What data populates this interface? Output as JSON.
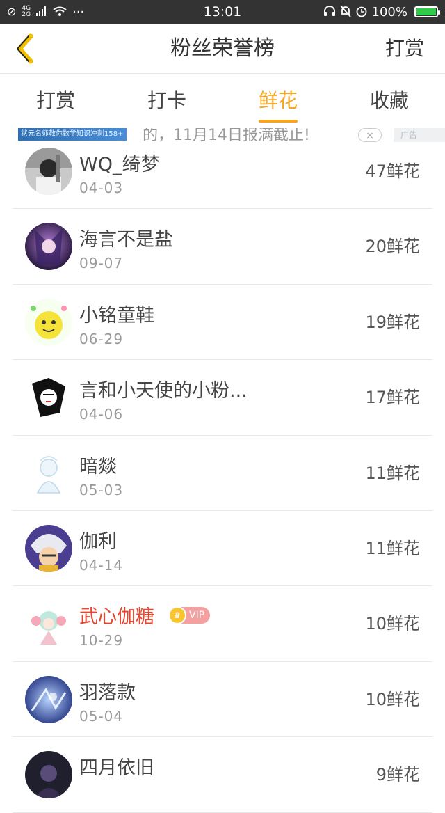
{
  "status_bar": {
    "time": "13:01",
    "network_label_top": "4G",
    "network_label_bottom": "2G",
    "more_glyph": "···",
    "battery_text": "100%",
    "battery_level": 1.0,
    "icons": [
      "blocked-icon",
      "signal-icon",
      "wifi-icon",
      "headset-icon",
      "mute-icon",
      "alarm-icon",
      "battery-charging-icon"
    ]
  },
  "header": {
    "title": "粉丝荣誉榜",
    "action_label": "打赏",
    "back_icon": "chevron-left-icon",
    "accent_color": "#f5a623"
  },
  "tabs": [
    {
      "label": "打赏",
      "active": false
    },
    {
      "label": "打卡",
      "active": false
    },
    {
      "label": "鲜花",
      "active": true
    },
    {
      "label": "收藏",
      "active": false
    }
  ],
  "ad": {
    "thumb_text": "状元名师教你数学知识冲刺158+",
    "text": "的，11月14日报满截止!",
    "close_glyph": "×",
    "mark_text": "广告"
  },
  "fans": [
    {
      "name": "WQ_绮梦",
      "date": "04-03",
      "count": "47鲜花",
      "vip": false
    },
    {
      "name": "海言不是盐",
      "date": "09-07",
      "count": "20鲜花",
      "vip": false
    },
    {
      "name": "小铭童鞋",
      "date": "06-29",
      "count": "19鲜花",
      "vip": false
    },
    {
      "name": "言和小天使的小粉...",
      "date": "04-06",
      "count": "17鲜花",
      "vip": false
    },
    {
      "name": "暗燚",
      "date": "05-03",
      "count": "11鲜花",
      "vip": false
    },
    {
      "name": "伽利",
      "date": "04-14",
      "count": "11鲜花",
      "vip": false
    },
    {
      "name": "武心伽糖",
      "date": "10-29",
      "count": "10鲜花",
      "vip": true,
      "vip_label": "VIP"
    },
    {
      "name": "羽落款",
      "date": "05-04",
      "count": "10鲜花",
      "vip": false
    },
    {
      "name": "四月依旧",
      "date": "",
      "count": "9鲜花",
      "vip": false
    }
  ]
}
